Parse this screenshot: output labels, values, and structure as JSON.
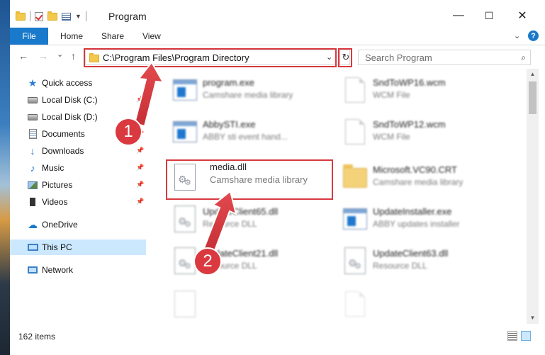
{
  "window": {
    "title": "Program",
    "minimize": "—",
    "maximize": "☐",
    "close": "✕"
  },
  "ribbon": {
    "file": "File",
    "tabs": [
      "Home",
      "Share",
      "View"
    ],
    "help": "?"
  },
  "nav": {
    "back": "←",
    "forward": "→",
    "recent": "⌄",
    "up": "↑",
    "address": "C:\\Program Files\\Program Directory",
    "refresh": "↻",
    "search_placeholder": "Search Program",
    "search_icon": "⌕"
  },
  "sidebar": {
    "items": [
      {
        "label": "Quick access",
        "icon": "star-icon"
      },
      {
        "label": "Local Disk (C:)",
        "icon": "drive-icon",
        "pinned": true
      },
      {
        "label": "Local Disk (D:)",
        "icon": "drive-icon",
        "pinned": true
      },
      {
        "label": "Documents",
        "icon": "documents-icon",
        "pinned": true
      },
      {
        "label": "Downloads",
        "icon": "download-icon",
        "pinned": true
      },
      {
        "label": "Music",
        "icon": "music-icon",
        "pinned": true
      },
      {
        "label": "Pictures",
        "icon": "pictures-icon",
        "pinned": true
      },
      {
        "label": "Videos",
        "icon": "videos-icon",
        "pinned": true
      },
      {
        "label": "OneDrive",
        "icon": "cloud-icon"
      },
      {
        "label": "This PC",
        "icon": "computer-icon",
        "selected": true
      },
      {
        "label": "Network",
        "icon": "network-icon"
      }
    ]
  },
  "files": [
    {
      "name": "program.exe",
      "desc": "Camshare media library",
      "icon": "exe-icon"
    },
    {
      "name": "SndToWP16.wcm",
      "desc": "WCM File",
      "icon": "file-icon"
    },
    {
      "name": "AbbySTI.exe",
      "desc": "ABBY sti event hand...",
      "icon": "exe-icon"
    },
    {
      "name": "SndToWP12.wcm",
      "desc": "WCM File",
      "icon": "file-icon"
    },
    {
      "name": "media.dll",
      "desc": "Camshare media library",
      "icon": "dll-icon"
    },
    {
      "name": "Microsoft.VC90.CRT",
      "desc": "Camshare media library",
      "icon": "folder-icon"
    },
    {
      "name": "UpdateClient65.dll",
      "desc": "Resource DLL",
      "icon": "dll-icon"
    },
    {
      "name": "UpdateInstaller.exe",
      "desc": "ABBY updates installer",
      "icon": "exe-icon"
    },
    {
      "name": "UpdateClient21.dll",
      "desc": "Resource DLL",
      "icon": "dll-icon"
    },
    {
      "name": "UpdateClient63.dll",
      "desc": "Resource DLL",
      "icon": "dll-icon"
    }
  ],
  "status": {
    "items_count": "162 items"
  },
  "annotations": {
    "step1": "1",
    "step2": "2",
    "color": "#d9393f"
  },
  "colors": {
    "accent": "#1979ca",
    "selected": "#cce8ff"
  }
}
